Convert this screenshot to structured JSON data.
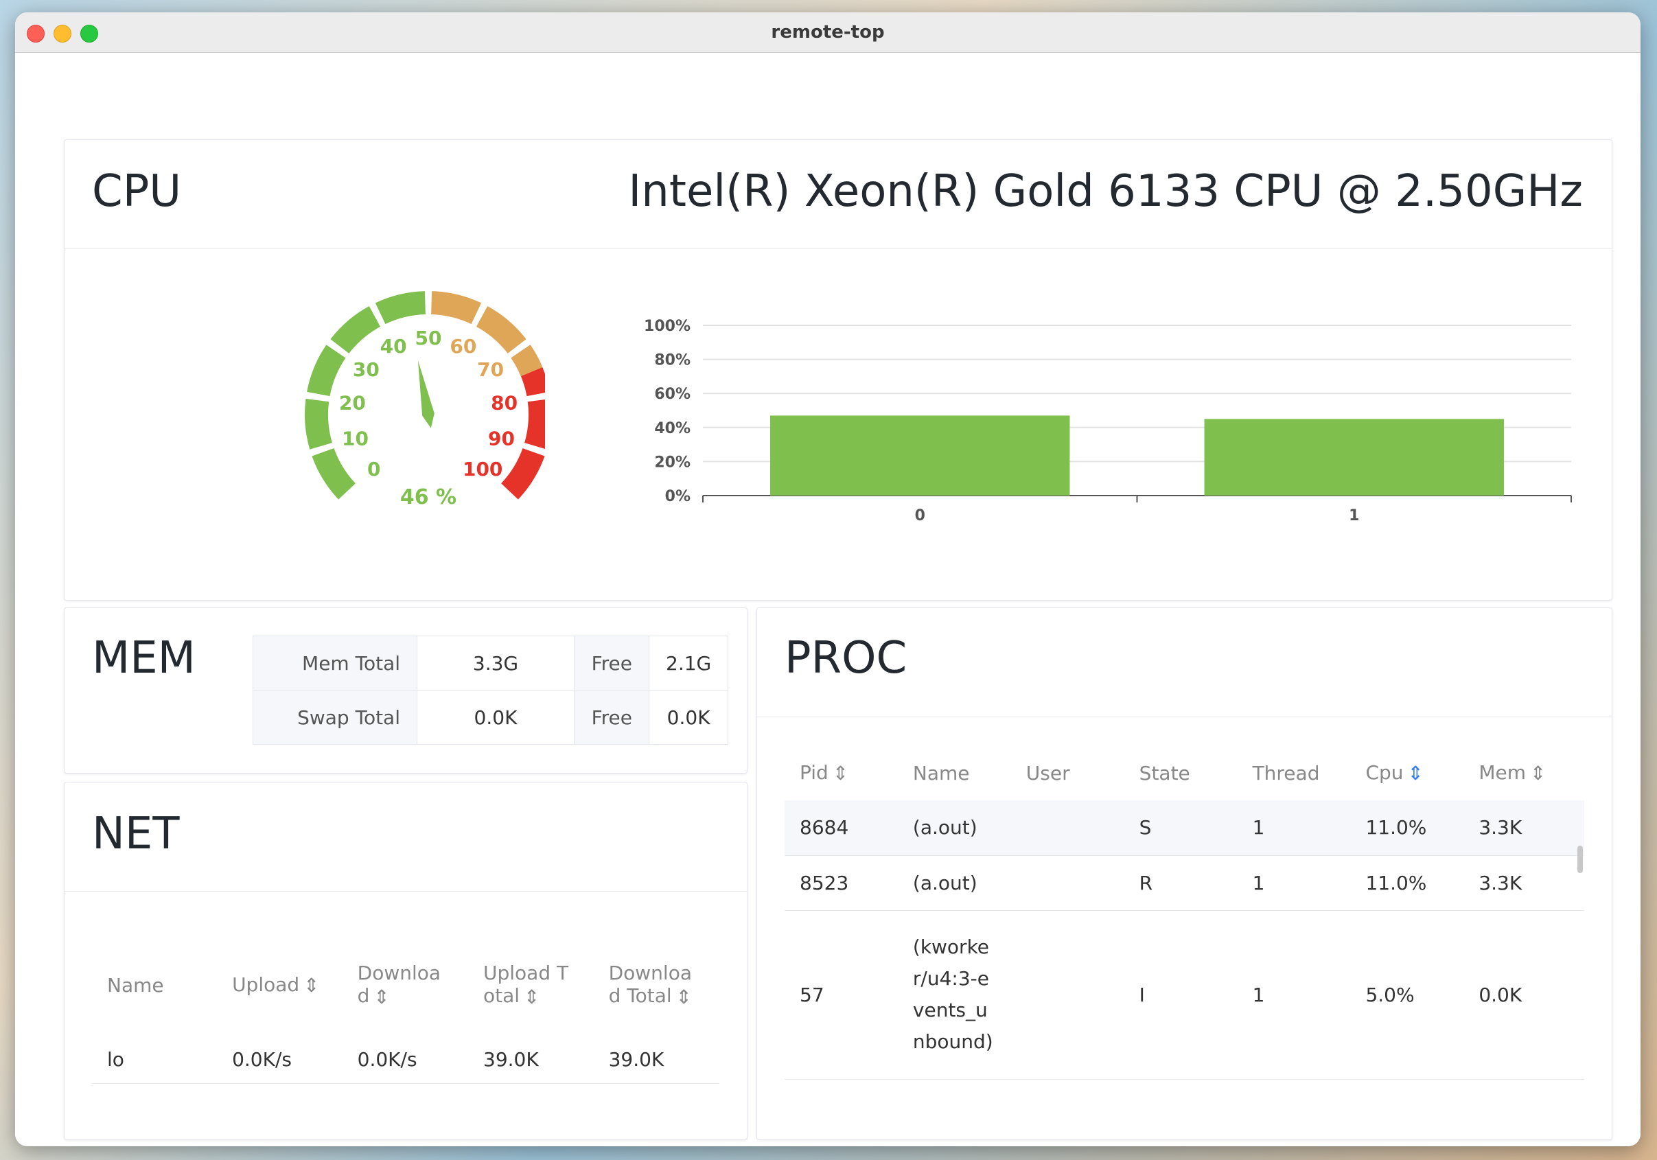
{
  "window": {
    "title": "remote-top"
  },
  "cpu": {
    "title": "CPU",
    "model": "Intel(R) Xeon(R) Gold 6133 CPU @ 2.50GHz",
    "gauge": {
      "value": 46,
      "label": "46 %",
      "ticks": [
        "0",
        "10",
        "20",
        "30",
        "40",
        "50",
        "60",
        "70",
        "80",
        "90",
        "100"
      ],
      "colors": {
        "green": "#7fbf4d",
        "orange": "#e0a657",
        "red": "#e63329"
      }
    }
  },
  "chart_data": {
    "type": "bar",
    "categories": [
      "0",
      "1"
    ],
    "values": [
      47,
      45
    ],
    "ylim": [
      0,
      100
    ],
    "yticks": [
      "0%",
      "20%",
      "40%",
      "60%",
      "80%",
      "100%"
    ],
    "bar_color": "#7fbf4d",
    "grid": true
  },
  "mem": {
    "title": "MEM",
    "rows": [
      {
        "label": "Mem Total",
        "value": "3.3G",
        "free_label": "Free",
        "free_value": "2.1G"
      },
      {
        "label": "Swap Total",
        "value": "0.0K",
        "free_label": "Free",
        "free_value": "0.0K"
      }
    ]
  },
  "net": {
    "title": "NET",
    "columns": [
      "Name",
      "Upload",
      "Downloa d",
      "Upload T otal",
      "Downloa d Total"
    ],
    "rows": [
      {
        "name": "lo",
        "upload": "0.0K/s",
        "download": "0.0K/s",
        "upload_total": "39.0K",
        "download_total": "39.0K"
      }
    ]
  },
  "proc": {
    "title": "PROC",
    "columns": [
      "Pid",
      "Name",
      "User",
      "State",
      "Thread",
      "Cpu",
      "Mem"
    ],
    "rows": [
      {
        "pid": "8684",
        "name": "(a.out)",
        "user": "",
        "state": "S",
        "thread": "1",
        "cpu": "11.0%",
        "mem": "3.3K"
      },
      {
        "pid": "8523",
        "name": "(a.out)",
        "user": "",
        "state": "R",
        "thread": "1",
        "cpu": "11.0%",
        "mem": "3.3K"
      },
      {
        "pid": "57",
        "name": "(kworker/u4:3-events_unbound)",
        "user": "",
        "state": "I",
        "thread": "1",
        "cpu": "5.0%",
        "mem": "0.0K"
      }
    ]
  }
}
